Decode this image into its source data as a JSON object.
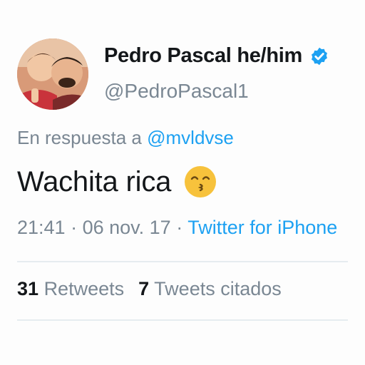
{
  "author": {
    "display_name": "Pedro Pascal he/him",
    "handle": "@PedroPascal1",
    "verified": true,
    "verified_color": "#1da1f2"
  },
  "reply": {
    "prefix": "En respuesta a ",
    "mention": "@mvldvse"
  },
  "tweet": {
    "text": "Wachita rica",
    "emoji": "kissing-face-smiling-eyes"
  },
  "meta": {
    "time": "21:41",
    "separator1": " · ",
    "date": "06 nov. 17",
    "separator2": " · ",
    "source": "Twitter for iPhone"
  },
  "stats": {
    "retweets_count": "31",
    "retweets_label": "Retweets",
    "quotes_count": "7",
    "quotes_label": "Tweets citados"
  },
  "colors": {
    "accent": "#1da1f2",
    "text_primary": "#14171a",
    "text_secondary": "#7a8793"
  }
}
